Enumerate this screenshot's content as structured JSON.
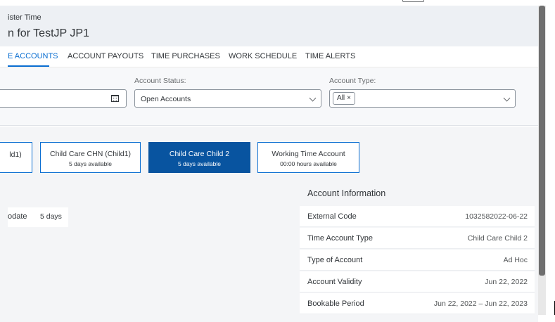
{
  "header": {
    "breadcrumb": "ister Time",
    "title": "n for TestJP JP1"
  },
  "tabs": [
    {
      "label": "E ACCOUNTS",
      "active": true
    },
    {
      "label": "ACCOUNT PAYOUTS",
      "active": false
    },
    {
      "label": "TIME PURCHASES",
      "active": false
    },
    {
      "label": "WORK SCHEDULE",
      "active": false
    },
    {
      "label": "TIME ALERTS",
      "active": false
    }
  ],
  "filters": {
    "account_status_label": "Account Status:",
    "account_status_value": "Open Accounts",
    "account_type_label": "Account Type:",
    "account_type_token": "All",
    "token_remove_glyph": "×"
  },
  "tiles": [
    {
      "title": "ld1)",
      "subtitle": ""
    },
    {
      "title": "Child Care CHN (Child1)",
      "subtitle": "5 days available"
    },
    {
      "title": "Child Care Child 2",
      "subtitle": "5 days available"
    },
    {
      "title": "Working Time Account",
      "subtitle": "00:00 hours available"
    }
  ],
  "left_table": {
    "label": "odate",
    "value": "5 days"
  },
  "account_info": {
    "title": "Account Information",
    "rows": [
      {
        "key": "External Code",
        "value": "1032582022-06-22"
      },
      {
        "key": "Time Account Type",
        "value": "Child Care Child 2"
      },
      {
        "key": "Type of Account",
        "value": "Ad Hoc"
      },
      {
        "key": "Account Validity",
        "value": "Jun 22, 2022"
      },
      {
        "key": "Bookable Period",
        "value": "Jun 22, 2022 – Jun 22, 2023"
      }
    ]
  },
  "colors": {
    "accent": "#0a6ed1",
    "selected_tile": "#0854a0",
    "header_bg": "#edf0f4"
  }
}
